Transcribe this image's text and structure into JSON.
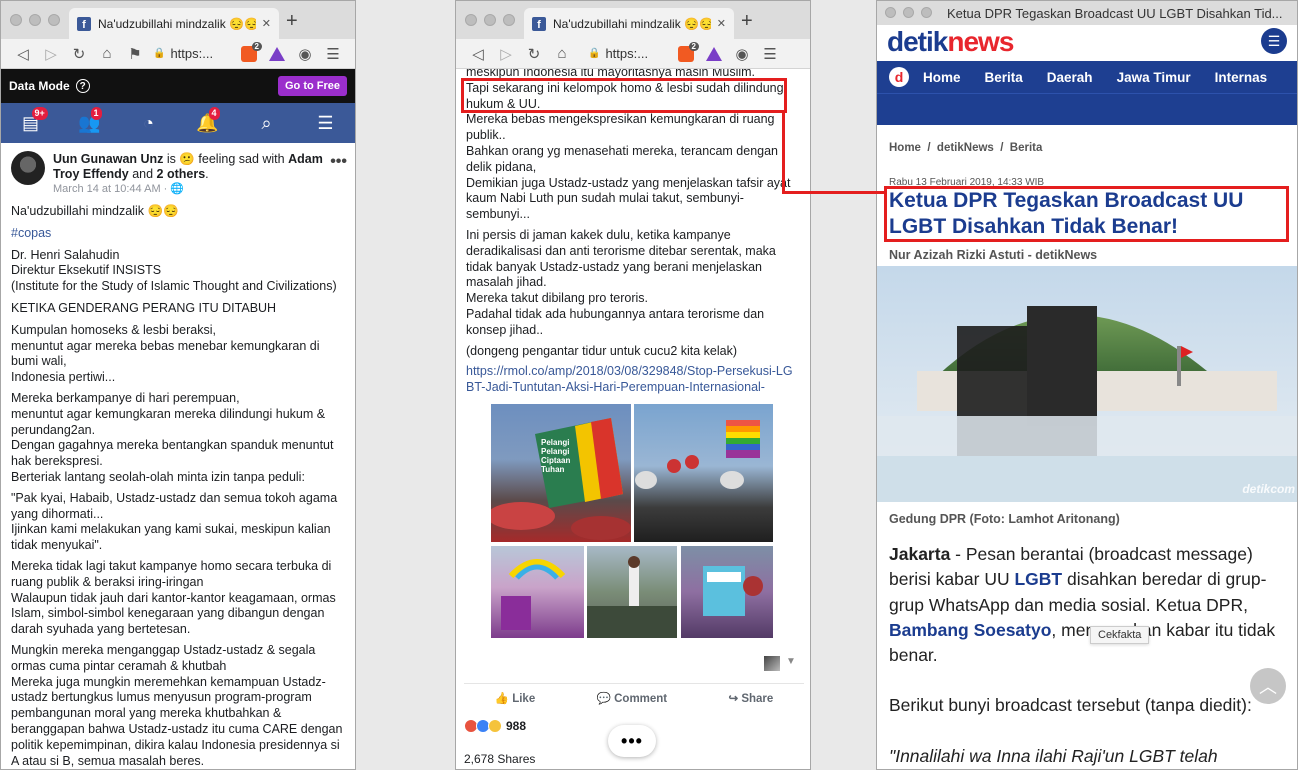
{
  "browser": {
    "fb_tab_title": "Na'udzubillahi mindzalik 😔😔 #",
    "url_short": "https:...",
    "brave_count": "2",
    "detik_window_title": "Ketua DPR Tegaskan Broadcast UU LGBT Disahkan Tid..."
  },
  "fb": {
    "data_mode_label": "Data Mode",
    "go_free_label": "Go to Free",
    "badges": {
      "home": "9+",
      "friends": "1",
      "notifications": "4"
    },
    "post": {
      "author_line": "Uun Gunawan Unz",
      "author_rest": " is 😕 feeling sad with ",
      "tag1": "Adam Troy Effendy",
      "and_text": " and ",
      "tag2": "2 others",
      "date": "March 14 at 10:44 AM · 🌐",
      "paragraphs_left": [
        "Na'udzubillahi mindzalik 😔😔",
        "#copas",
        "Dr. Henri Salahudin\nDirektur Eksekutif INSISTS\n(Institute for the Study of Islamic Thought and Civilizations)",
        "KETIKA GENDERANG PERANG ITU DITABUH",
        "Kumpulan homoseks & lesbi beraksi,\nmenuntut agar mereka bebas menebar kemungkaran di bumi wali,\nIndonesia pertiwi...",
        "Mereka berkampanye di hari perempuan,\nmenuntut agar kemungkaran mereka dilindungi hukum & perundang2an.\nDengan gagahnya mereka bentangkan spanduk menuntut hak berekspresi.\nBerteriak lantang seolah-olah minta izin tanpa peduli:",
        "\"Pak kyai, Habaib, Ustadz-ustadz dan semua tokoh agama yang dihormati...\nIjinkan kami melakukan yang kami sukai, meskipun kalian tidak menyukai\".",
        "Mereka tidak lagi takut kampanye homo secara terbuka di ruang publik & beraksi iring-iringan\nWalaupun tidak jauh dari kantor-kantor keagamaan, ormas Islam, simbol-simbol kenegaraan yang dibangun dengan darah syuhada yang bertetesan.",
        "Mungkin mereka menganggap Ustadz-ustadz & segala ormas cuma pintar ceramah & khutbah\nMereka juga mungkin meremehkan kemampuan Ustadz-ustadz bertungkus lumus menyusun program-program pembangunan moral yang mereka khutbahkan & beranggapan bahwa Ustadz-ustadz itu cuma CARE dengan politik kepemimpinan, dikira kalau Indonesia presidennya si A atau si B, semua masalah beres."
      ],
      "middle_top_partial": "meskipun Indonesia itu mayoritasnya masih Muslim.",
      "middle_highlight": "Tapi sekarang ini kelompok homo & lesbi sudah dilindungi hukum & UU.",
      "paragraphs_middle": [
        "Mereka bebas mengekspresikan kemungkaran di ruang publik..\nBahkan orang yg menasehati mereka, terancam dengan delik pidana,\nDemikian juga Ustadz-ustadz yang menjelaskan tafsir ayat kaum Nabi Luth pun sudah mulai takut, sembunyi-sembunyi...",
        "Ini persis di jaman kakek dulu, ketika kampanye deradikalisasi dan anti terorisme ditebar serentak, maka tidak banyak Ustadz-ustadz yang berani menjelaskan masalah jihad.\nMereka takut dibilang pro teroris.\nPadahal tidak ada hubungannya antara terorisme dan konsep jihad..",
        "(dongeng pengantar tidur untuk cucu2 kita kelak)"
      ],
      "link": "https://rmol.co/amp/2018/03/08/329848/Stop-Persekusi-LGBT-Jadi-Tuntutan-Aksi-Hari-Perempuan-Internasional-",
      "photo_sign_text": "Pelangi Pelangi Ciptaan Tuhan",
      "like_label": "Like",
      "comment_label": "Comment",
      "share_label": "Share",
      "reaction_count": "988",
      "shares": "2,678 Shares"
    }
  },
  "detik": {
    "logo_a": "detik",
    "logo_b": "news",
    "nav": [
      "Home",
      "Berita",
      "Daerah",
      "Jawa Timur",
      "Internas"
    ],
    "breadcrumb": "Home  /  detikNews  /  Berita",
    "date": "Rabu 13 Februari 2019, 14:33 WIB",
    "title": "Ketua DPR Tegaskan Broadcast UU LGBT Disahkan Tidak Benar!",
    "author": "Nur Azizah Rizki Astuti - detikNews",
    "watermark": "detikcom",
    "caption": "Gedung DPR (Foto: Lamhot Aritonang)",
    "lead_city": "Jakarta",
    "lead_1": " - Pesan berantai (broadcast message) berisi kabar UU ",
    "lead_link1": "LGBT",
    "lead_2": " disahkan beredar di grup-grup WhatsApp dan media sosial. Ketua DPR, ",
    "lead_link2": "Bambang Soesatyo",
    "lead_3": ", menegaskan kabar itu tidak benar.",
    "tooltip": "Cekfakta",
    "para2": "Berikut bunyi broadcast tersebut (tanpa diedit):",
    "para3": "\"Innalilahi wa Inna ilahi Raji'un LGBT telah"
  },
  "colors": {
    "fb_blue": "#3b5998",
    "detik_blue": "#1e3f91",
    "detik_red": "#e8262d",
    "annotation_red": "#e41e1e"
  }
}
